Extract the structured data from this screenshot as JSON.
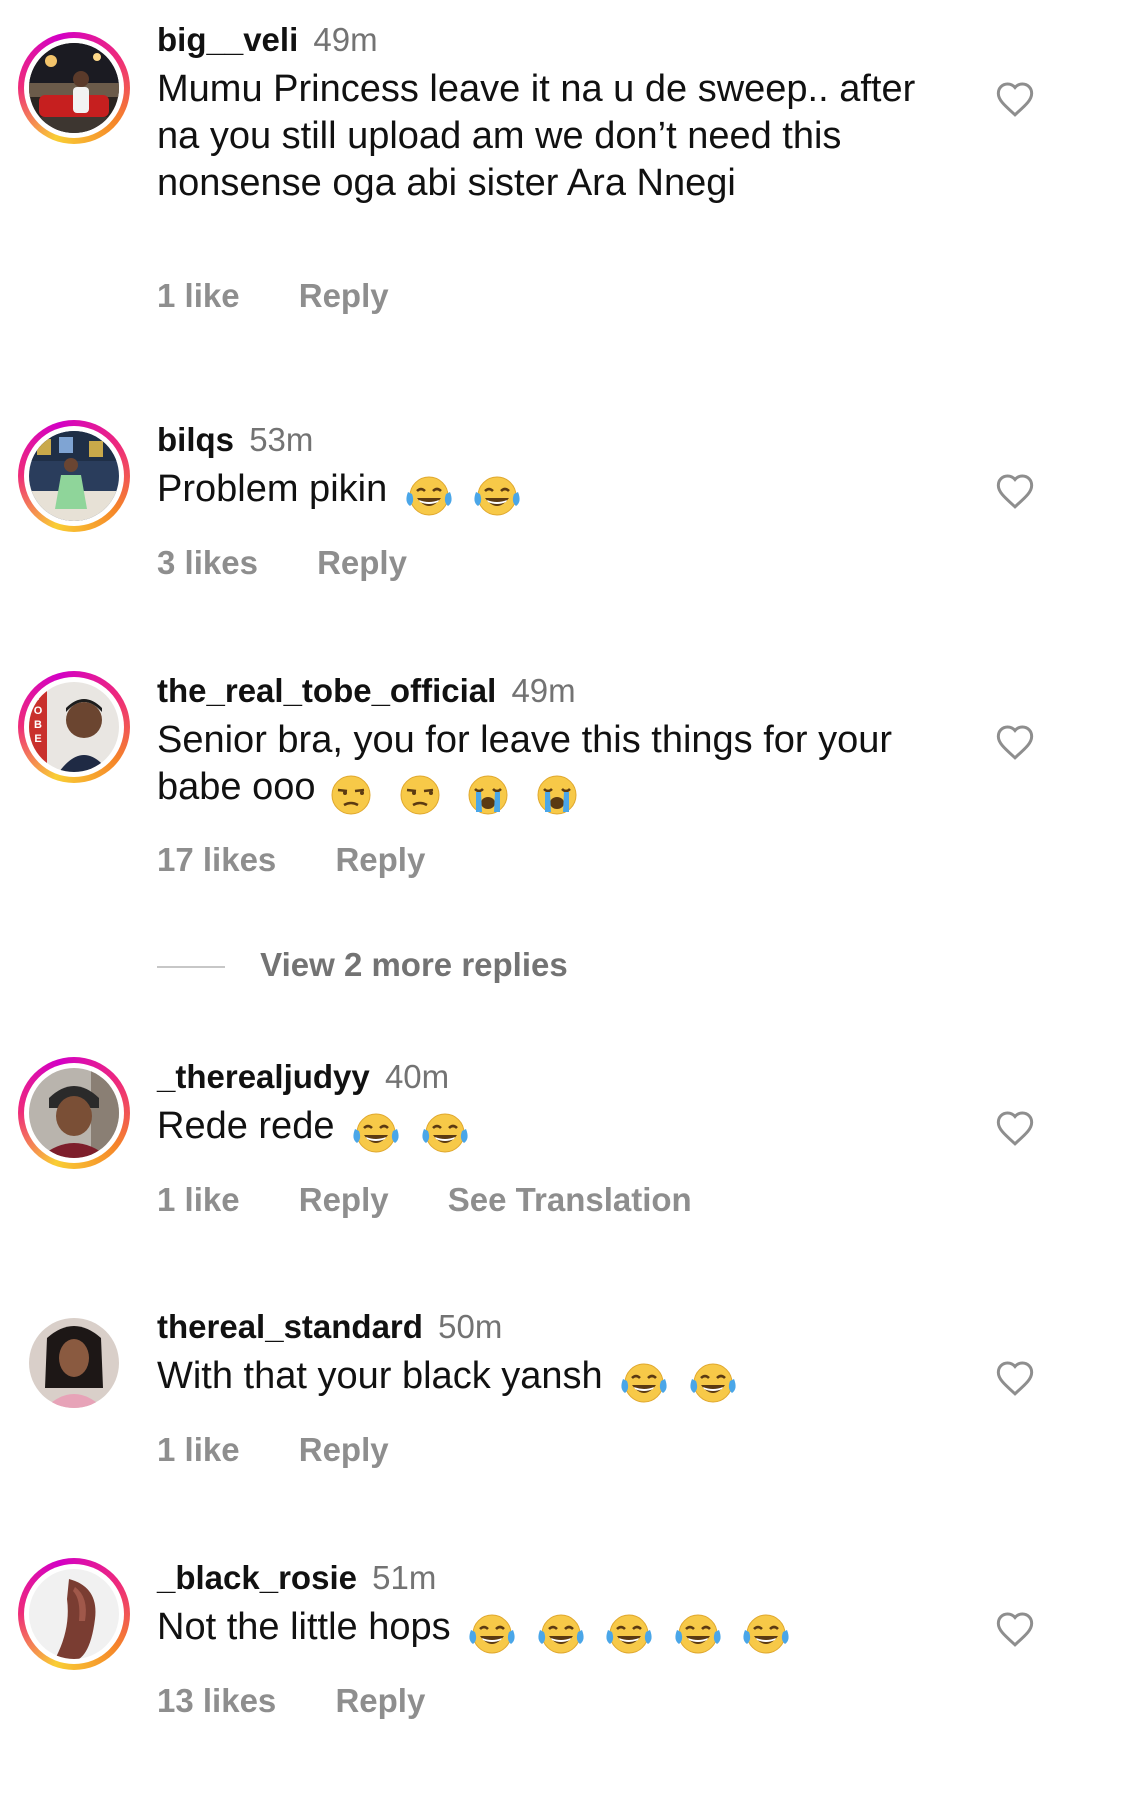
{
  "comments": [
    {
      "username": "big__veli",
      "time": "49m",
      "text": "Mumu Princess leave it na u de sweep.. after na you still upload am we don’t need this nonsense oga abi sister Ara Nnegi",
      "emojis": [],
      "likes": "1 like",
      "reply": "Reply",
      "translate": "",
      "story_ring": true,
      "avatar": "avatar-photo"
    },
    {
      "username": "bilqs",
      "time": "53m",
      "text": "Problem pikin",
      "emojis": [
        "tears-of-joy",
        "tears-of-joy"
      ],
      "likes": "3 likes",
      "reply": "Reply",
      "translate": "",
      "story_ring": true,
      "avatar": "avatar-photo"
    },
    {
      "username": "the_real_tobe_official",
      "time": "49m",
      "text": "Senior bra, you for leave this things for your babe ooo",
      "emojis": [
        "unamused",
        "unamused",
        "loudly-crying",
        "loudly-crying"
      ],
      "likes": "17 likes",
      "reply": "Reply",
      "translate": "",
      "story_ring": true,
      "avatar": "avatar-photo"
    },
    {
      "username": "_therealjudyy",
      "time": "40m",
      "text": "Rede rede",
      "emojis": [
        "tears-of-joy",
        "tears-of-joy"
      ],
      "likes": "1 like",
      "reply": "Reply",
      "translate": "See Translation",
      "story_ring": true,
      "avatar": "avatar-photo"
    },
    {
      "username": "thereal_standard",
      "time": "50m",
      "text": "With that your black yansh",
      "emojis": [
        "tears-of-joy",
        "tears-of-joy"
      ],
      "likes": "1 like",
      "reply": "Reply",
      "translate": "",
      "story_ring": false,
      "avatar": "avatar-photo"
    },
    {
      "username": "_black_rosie",
      "time": "51m",
      "text": "Not the little hops",
      "emojis": [
        "tears-of-joy",
        "tears-of-joy",
        "tears-of-joy",
        "tears-of-joy",
        "tears-of-joy"
      ],
      "likes": "13 likes",
      "reply": "Reply",
      "translate": "",
      "story_ring": true,
      "avatar": "avatar-photo"
    }
  ],
  "view_more": {
    "label": "View 2 more replies"
  },
  "icons": {
    "like": "heart-outline-icon"
  },
  "colors": {
    "text": "#111111",
    "secondary": "#737373",
    "action": "#8e8e8e",
    "ring_start": "#f9ce34",
    "ring_mid": "#ee2a7b",
    "ring_end": "#d300c5"
  }
}
